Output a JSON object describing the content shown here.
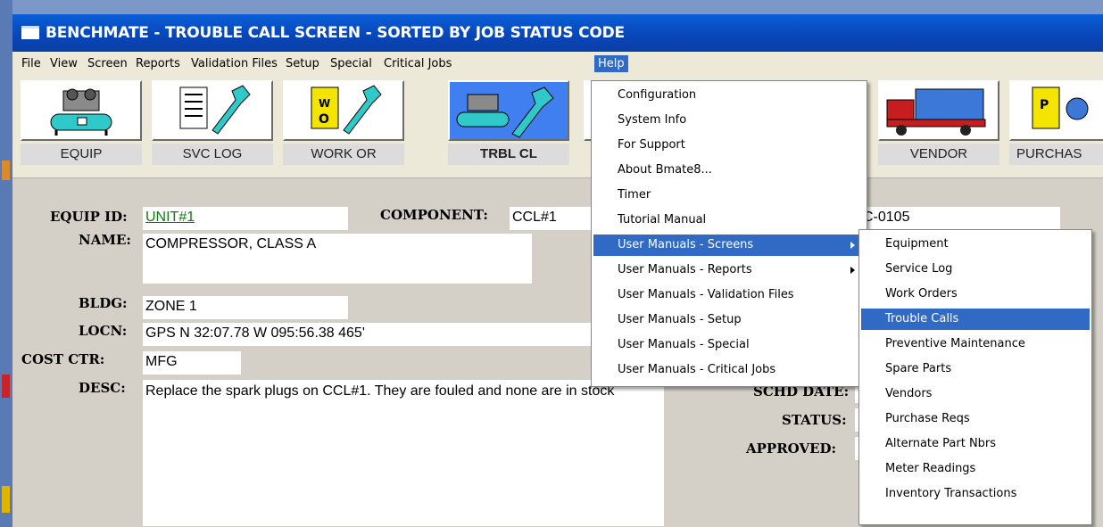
{
  "window": {
    "title": "BENCHMATE - TROUBLE CALL SCREEN - SORTED BY JOB STATUS CODE"
  },
  "menubar": [
    "File",
    "View",
    "Screen",
    "Reports",
    "Validation Files",
    "Setup",
    "Special",
    "Critical Jobs",
    "Help"
  ],
  "toolbar": [
    {
      "label": "EQUIP",
      "icon": "compressor-icon"
    },
    {
      "label": "SVC LOG",
      "icon": "service-log-icon"
    },
    {
      "label": "WORK OR",
      "icon": "work-order-icon"
    },
    {
      "label": "TRBL CL",
      "icon": "trouble-call-icon",
      "selected": true
    },
    {
      "label": "VENDOR",
      "icon": "vendor-truck-icon"
    },
    {
      "label": "PURCHAS",
      "icon": "purchase-icon"
    }
  ],
  "form": {
    "equip_id_label": "EQUIP ID:",
    "equip_id": "UNIT#1",
    "component_label": "COMPONENT:",
    "component": "CCL#1",
    "name_label": "NAME:",
    "name": "COMPRESSOR, CLASS A",
    "bldg_label": "BLDG:",
    "bldg": "ZONE 1",
    "locn_label": "LOCN:",
    "locn": "GPS N 32:07.78 W 095:56.38  465'",
    "cost_ctr_label": "COST CTR:",
    "cost_ctr": "MFG",
    "desc_label": "DESC:",
    "desc": "Replace the spark plugs on CCL#1.  They are fouled and none are in stock",
    "right_value_1": "C-0105",
    "schd_date_label": "SCHD DATE:",
    "status_label": "STATUS:",
    "approved_label": "APPROVED:"
  },
  "help_menu": [
    "Configuration",
    "System Info",
    "For Support",
    "About Bmate8...",
    "Timer",
    "Tutorial Manual",
    "User Manuals - Screens",
    "User Manuals - Reports",
    "User Manuals - Validation Files",
    "User Manuals - Setup",
    "User Manuals - Special",
    "User Manuals - Critical Jobs"
  ],
  "screens_submenu": [
    "Equipment",
    "Service Log",
    "Work Orders",
    "Trouble Calls",
    "Preventive Maintenance",
    "Spare Parts",
    "Vendors",
    "Purchase Reqs",
    "Alternate Part Nbrs",
    "Meter Readings",
    "Inventory Transactions"
  ],
  "colors": {
    "title_bar": "#0846ba",
    "menu_highlight": "#316ac5",
    "link_green": "#127a12",
    "form_bg": "#d4d0c8"
  }
}
